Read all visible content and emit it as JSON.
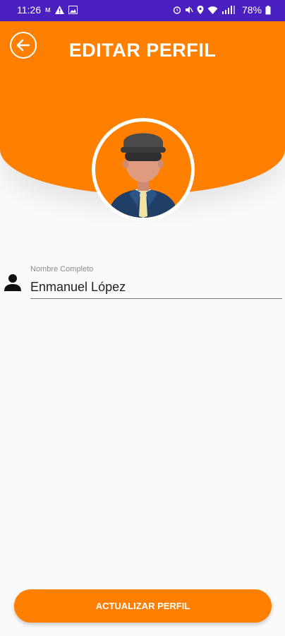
{
  "status_bar": {
    "time": "11:26",
    "battery": "78%",
    "icons": [
      "m-icon",
      "warning-icon",
      "image-icon",
      "alarm-icon",
      "mute-icon",
      "location-icon",
      "wifi-icon",
      "signal-icon",
      "battery-icon"
    ]
  },
  "header": {
    "title": "EDITAR PERFIL",
    "back_icon": "arrow-left-icon"
  },
  "profile": {
    "avatar": "avatar-illustration"
  },
  "form": {
    "name_label": "Nombre Completo",
    "name_value": "Enmanuel López",
    "name_icon": "person-icon"
  },
  "actions": {
    "update_label": "ACTUALIZAR PERFIL"
  },
  "colors": {
    "status_bar": "#4a1fc0",
    "primary": "#ff7f00",
    "background": "#fafafa"
  }
}
